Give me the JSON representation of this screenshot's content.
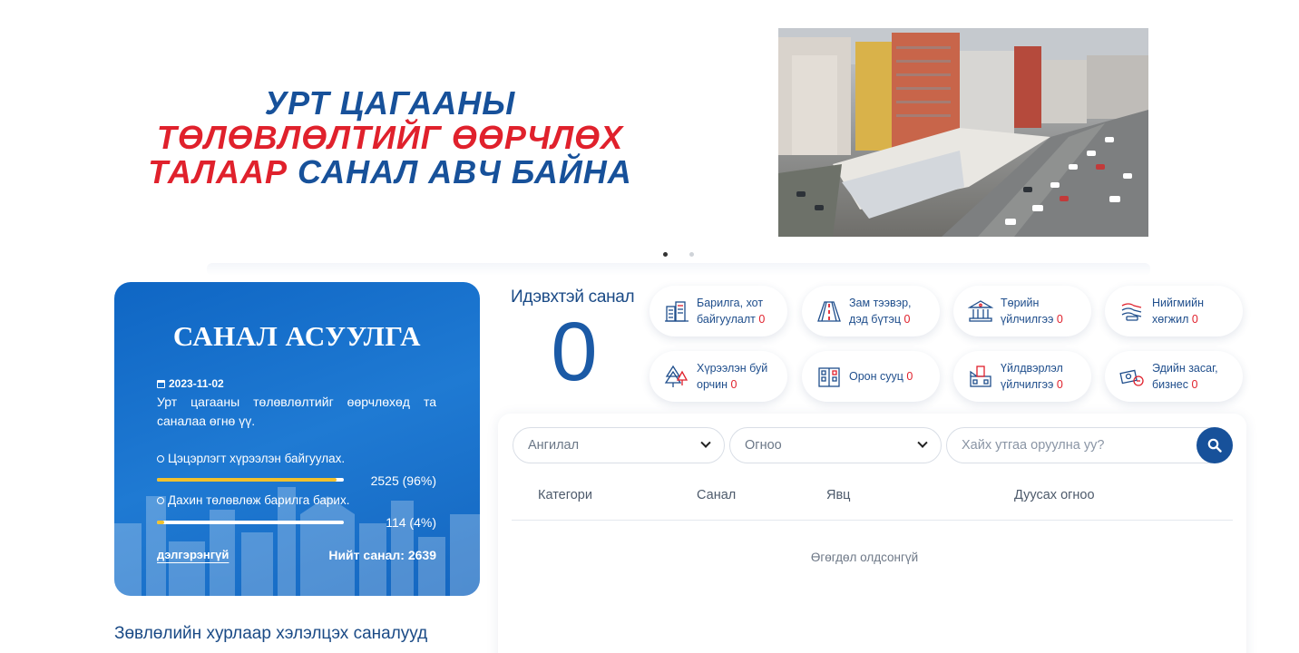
{
  "hero": {
    "title_line1": "УРТ ЦАГААНЫ",
    "title_line2": "ТӨЛӨВЛӨЛТИЙГ ӨӨРЧЛӨХ",
    "title_line3_red": "ТАЛААР",
    "title_line3_blue": "САНАЛ АВЧ БАЙНА"
  },
  "carousel": {
    "slides": 2,
    "active": 1
  },
  "poll": {
    "title": "САНАЛ АСУУЛГА",
    "date": "2023-11-02",
    "description": "Урт цагааны төлөвлөлтийг өөрчлөхөд та саналаа өгнө үү.",
    "options": [
      {
        "label": "Цэцэрлэгт хүрээлэн байгуулах.",
        "count_text": "2525 (96%)",
        "share": 0.96
      },
      {
        "label": "Дахин төлөвлөж барилга барих.",
        "count_text": "114 (4%)",
        "share": 0.04
      }
    ],
    "more_link": "дэлгэрэнгүй",
    "total": "Нийт санал: 2639"
  },
  "council_heading": "Зөвлөлийн хурлаар хэлэлцэх саналууд",
  "active": {
    "label": "Идэвхтэй санал",
    "count": "0"
  },
  "categories": [
    {
      "line1": "Барилга, хот",
      "line2": "байгуулалт",
      "count": "0",
      "icon": "building-icon"
    },
    {
      "line1": "Зам тээвэр,",
      "line2": "дэд бүтэц",
      "count": "0",
      "icon": "road-icon"
    },
    {
      "line1": "Төрийн",
      "line2": "үйлчилгээ",
      "count": "0",
      "icon": "government-icon"
    },
    {
      "line1": "Нийгмийн",
      "line2": "хөгжил",
      "count": "0",
      "icon": "social-hands-icon"
    },
    {
      "line1": "Хүрээлэн буй",
      "line2": "орчин",
      "count": "0",
      "icon": "tree-icon"
    },
    {
      "line1": "Орон сууц",
      "line2": "",
      "count": "0",
      "icon": "apartment-icon"
    },
    {
      "line1": "Үйлдвэрлэл",
      "line2": "үйлчилгээ",
      "count": "0",
      "icon": "factory-icon"
    },
    {
      "line1": "Эдийн засаг,",
      "line2": "бизнес",
      "count": "0",
      "icon": "money-icon"
    }
  ],
  "filters": {
    "category_select": "Ангилал",
    "date_select": "Огноо",
    "search_placeholder": "Хайх утгаа оруулна уу?"
  },
  "table": {
    "headers": [
      "Категори",
      "Санал",
      "Явц",
      "Дуусах огноо"
    ],
    "empty_text": "Өгөгдөл олдсонгүй"
  },
  "colors": {
    "primary": "#17519a",
    "accent_red": "#e0212c",
    "bar_yellow": "#f1c12d",
    "card_blue": "#1a72cf"
  }
}
